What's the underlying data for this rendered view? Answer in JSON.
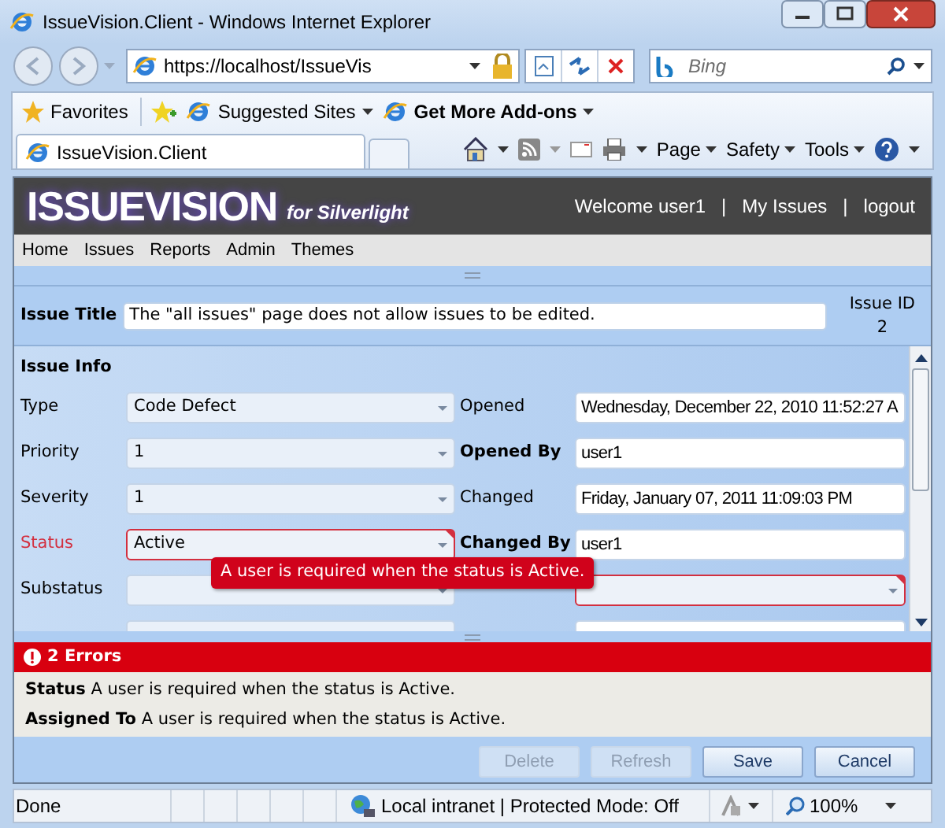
{
  "window": {
    "title": "IssueVision.Client - Windows Internet Explorer"
  },
  "browser": {
    "address": "https://localhost/IssueVis",
    "search_placeholder": "Bing",
    "favorites": [
      {
        "label": "Favorites",
        "kind": "favorites"
      },
      {
        "label": "Suggested Sites",
        "kind": "menu"
      },
      {
        "label": "Get More Add-ons",
        "kind": "menu"
      }
    ],
    "tab": {
      "label": "IssueVision.Client",
      "selected": true
    },
    "commands": [
      "Page",
      "Safety",
      "Tools"
    ]
  },
  "app": {
    "logo": "ISSUEVISION",
    "subtitle": "for Silverlight",
    "welcome": "Welcome user1",
    "header_links": [
      {
        "separator": "|",
        "label": "My Issues"
      },
      {
        "separator": "|",
        "label": "logout"
      }
    ],
    "nav": [
      "Home",
      "Issues",
      "Reports",
      "Admin",
      "Themes"
    ],
    "issue_title": {
      "label": "Issue Title",
      "value": "The \"all issues\" page does not allow issues to be edited."
    },
    "issue_id": {
      "label": "Issue ID",
      "value": "2"
    },
    "section": "Issue Info",
    "left_fields": [
      {
        "label": "Type",
        "value": "Code Defect",
        "error": false
      },
      {
        "label": "Priority",
        "value": "1",
        "error": false
      },
      {
        "label": "Severity",
        "value": "1",
        "error": false
      },
      {
        "label": "Status",
        "value": "Active",
        "error": true
      },
      {
        "label": "Substatus",
        "error": false
      }
    ],
    "right_fields": [
      {
        "label": "Opened",
        "value": "Wednesday, December 22, 2010 11:52:27 A",
        "kind": "text",
        "required": false
      },
      {
        "label": "Opened By",
        "value": "user1",
        "kind": "text",
        "required": true
      },
      {
        "label": "Changed",
        "value": "Friday, January 07, 2011 11:09:03 PM",
        "kind": "text",
        "required": false
      },
      {
        "label": "Changed By",
        "value": "user1",
        "kind": "text",
        "required": true
      },
      {
        "kind": "combo",
        "error": true
      }
    ],
    "tooltip": "A user is required when the status is Active.",
    "errors": {
      "title": "2 Errors",
      "items": [
        {
          "field": "Status",
          "message": "A user is required when the status is Active."
        },
        {
          "field": "Assigned To",
          "message": "A user is required when the status is Active."
        }
      ]
    },
    "buttons": [
      {
        "label": "Delete",
        "disabled": true
      },
      {
        "label": "Refresh",
        "disabled": true
      },
      {
        "label": "Save",
        "disabled": false
      },
      {
        "label": "Cancel",
        "disabled": false
      }
    ]
  },
  "status_bar": {
    "text": "Done",
    "zone": "Local intranet | Protected Mode: Off",
    "zoom": "100%"
  }
}
